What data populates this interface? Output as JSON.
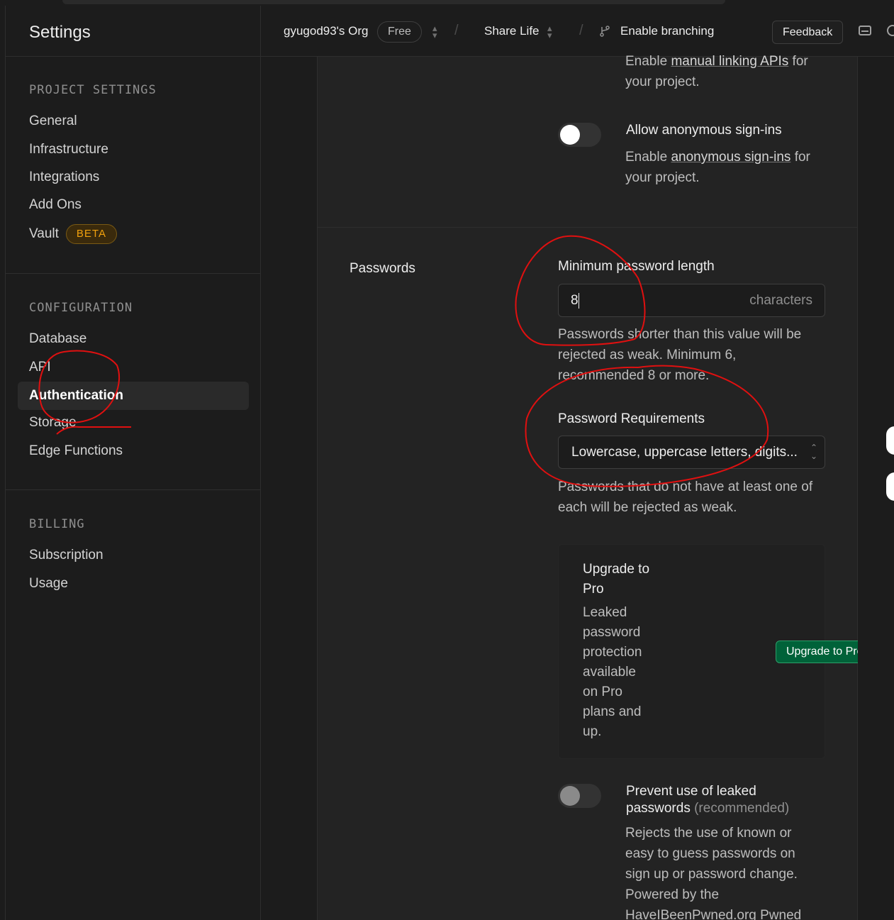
{
  "sidebar": {
    "title": "Settings",
    "sections": [
      {
        "heading": "PROJECT SETTINGS",
        "items": [
          "General",
          "Infrastructure",
          "Integrations",
          "Add Ons",
          "Vault"
        ]
      },
      {
        "heading": "CONFIGURATION",
        "items": [
          "Database",
          "API",
          "Authentication",
          "Storage",
          "Edge Functions"
        ]
      },
      {
        "heading": "BILLING",
        "items": [
          "Subscription",
          "Usage"
        ]
      }
    ],
    "vault_badge": "BETA",
    "active_item": "Authentication"
  },
  "topbar": {
    "org": "gyugod93's Org",
    "plan": "Free",
    "project": "Share Life",
    "branching": "Enable branching",
    "feedback": "Feedback"
  },
  "manual_linking": {
    "desc_pre": "Enable ",
    "desc_link": "manual linking APIs",
    "desc_post_1": " for",
    "desc_post_2": "your project."
  },
  "anonymous": {
    "label": "Allow anonymous sign-ins",
    "desc_pre": "Enable ",
    "desc_link": "anonymous sign-ins",
    "desc_post_1": " for",
    "desc_post_2": "your project.",
    "enabled": false
  },
  "passwords": {
    "section_title": "Passwords",
    "min_length_label": "Minimum password length",
    "min_length_value": "8",
    "min_length_suffix": "characters",
    "min_length_help_1": "Passwords shorter than this value will be",
    "min_length_help_2": "rejected as weak. Minimum 6,",
    "min_length_help_3": "recommended 8 or more.",
    "requirements_label": "Password Requirements",
    "requirements_value": "Lowercase, uppercase letters, digits...",
    "requirements_help_1": "Passwords that do not have at least one of",
    "requirements_help_2": "each will be rejected as weak."
  },
  "upgrade": {
    "title": "Upgrade to Pro",
    "desc": "Leaked password protection available on Pro plans and up.",
    "button": "Upgrade to Pro"
  },
  "leaked": {
    "label": "Prevent use of leaked",
    "label_2": "passwords",
    "label_suffix": "(recommended)",
    "desc_1": "Rejects the use of known or",
    "desc_2": "easy to guess passwords on",
    "desc_3": "sign up or password change.",
    "desc_4": "Powered by the",
    "desc_5": "HaveIBeenPwned.org Pwned",
    "enabled": false
  },
  "colors": {
    "background": "#1c1c1c",
    "panel": "#232323",
    "brand_green": "#006239",
    "beta_amber": "#f1a10d",
    "annotation_red": "#e01010"
  }
}
